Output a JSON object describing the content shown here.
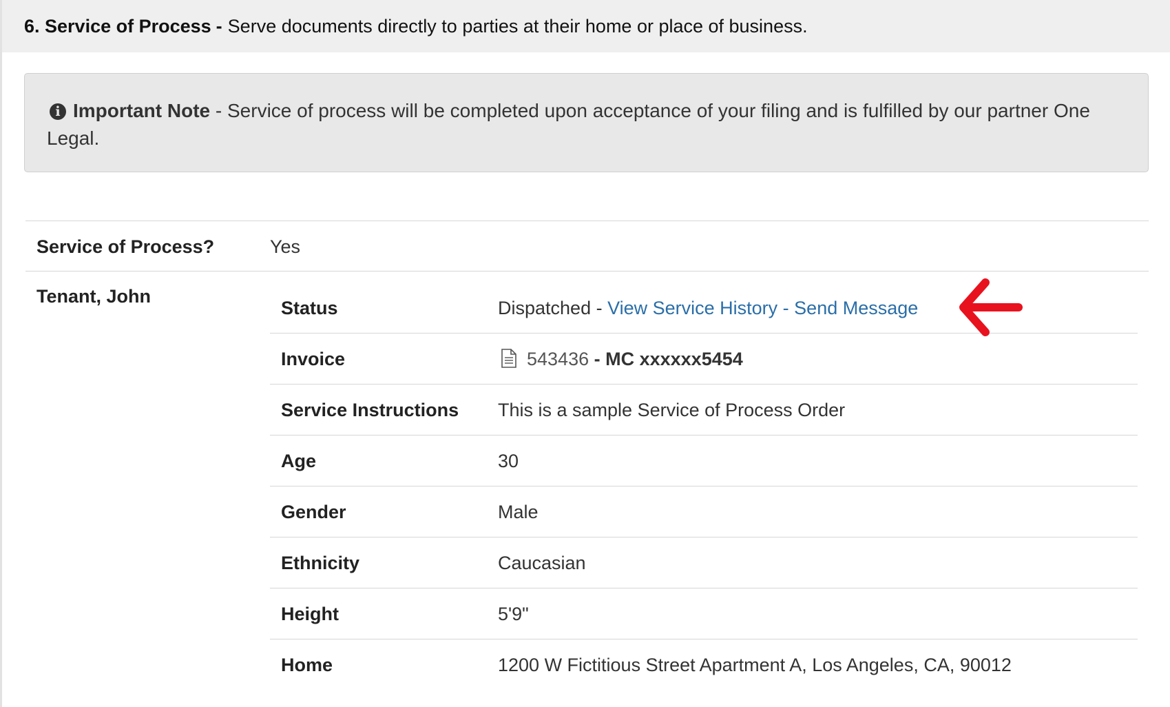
{
  "header": {
    "title": "6. Service of Process",
    "separator": "-",
    "description": "Serve documents directly to parties at their home or place of business."
  },
  "note": {
    "icon": "info-icon",
    "title": "Important Note",
    "text": " - Service of process will be completed upon acceptance of your filing and is fulfilled by our partner One Legal."
  },
  "service_of_process": {
    "label": "Service of Process?",
    "value": "Yes"
  },
  "party": {
    "name": "Tenant, John",
    "status": {
      "label": "Status",
      "value": "Dispatched",
      "separator": " - ",
      "history_link": "View Service History",
      "link_separator": " - ",
      "message_link": "Send Message"
    },
    "invoice": {
      "label": "Invoice",
      "icon": "document-icon",
      "number": "543436",
      "separator": " - ",
      "payment": "MC xxxxxx5454"
    },
    "instructions": {
      "label": "Service Instructions",
      "value": "This is a sample Service of Process Order"
    },
    "age": {
      "label": "Age",
      "value": "30"
    },
    "gender": {
      "label": "Gender",
      "value": "Male"
    },
    "ethnicity": {
      "label": "Ethnicity",
      "value": "Caucasian"
    },
    "height": {
      "label": "Height",
      "value": "5'9\""
    },
    "home": {
      "label": "Home",
      "value": "1200 W Fictitious Street Apartment A, Los Angeles, CA, 90012"
    }
  },
  "annotation": {
    "icon": "red-arrow-icon",
    "color": "#e8121e"
  },
  "colors": {
    "link": "#2a6ea8",
    "header_bg": "#efefef",
    "note_bg": "#e8e8e8"
  }
}
